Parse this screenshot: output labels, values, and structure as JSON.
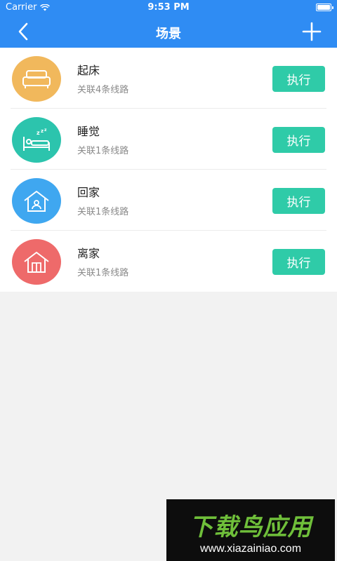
{
  "status_bar": {
    "carrier": "Carrier",
    "time": "9:53 PM"
  },
  "nav": {
    "title": "场景",
    "back_icon": "chevron-left-icon",
    "add_icon": "plus-icon"
  },
  "scenes": [
    {
      "name": "起床",
      "subtitle": "关联4条线路",
      "action": "执行",
      "icon": "bed-icon",
      "color": "#f1b85c"
    },
    {
      "name": "睡觉",
      "subtitle": "关联1条线路",
      "action": "执行",
      "icon": "sleep-icon",
      "color": "#2cc4ad"
    },
    {
      "name": "回家",
      "subtitle": "关联1条线路",
      "action": "执行",
      "icon": "home-person-icon",
      "color": "#3fa7f0"
    },
    {
      "name": "离家",
      "subtitle": "关联1条线路",
      "action": "执行",
      "icon": "home-door-icon",
      "color": "#ee6a6a"
    }
  ],
  "colors": {
    "primary": "#2f8cf3",
    "button": "#2fcba8",
    "background": "#f2f2f2"
  },
  "watermark": {
    "logo": "下载鸟应用",
    "url": "www.xiazainiao.com"
  }
}
